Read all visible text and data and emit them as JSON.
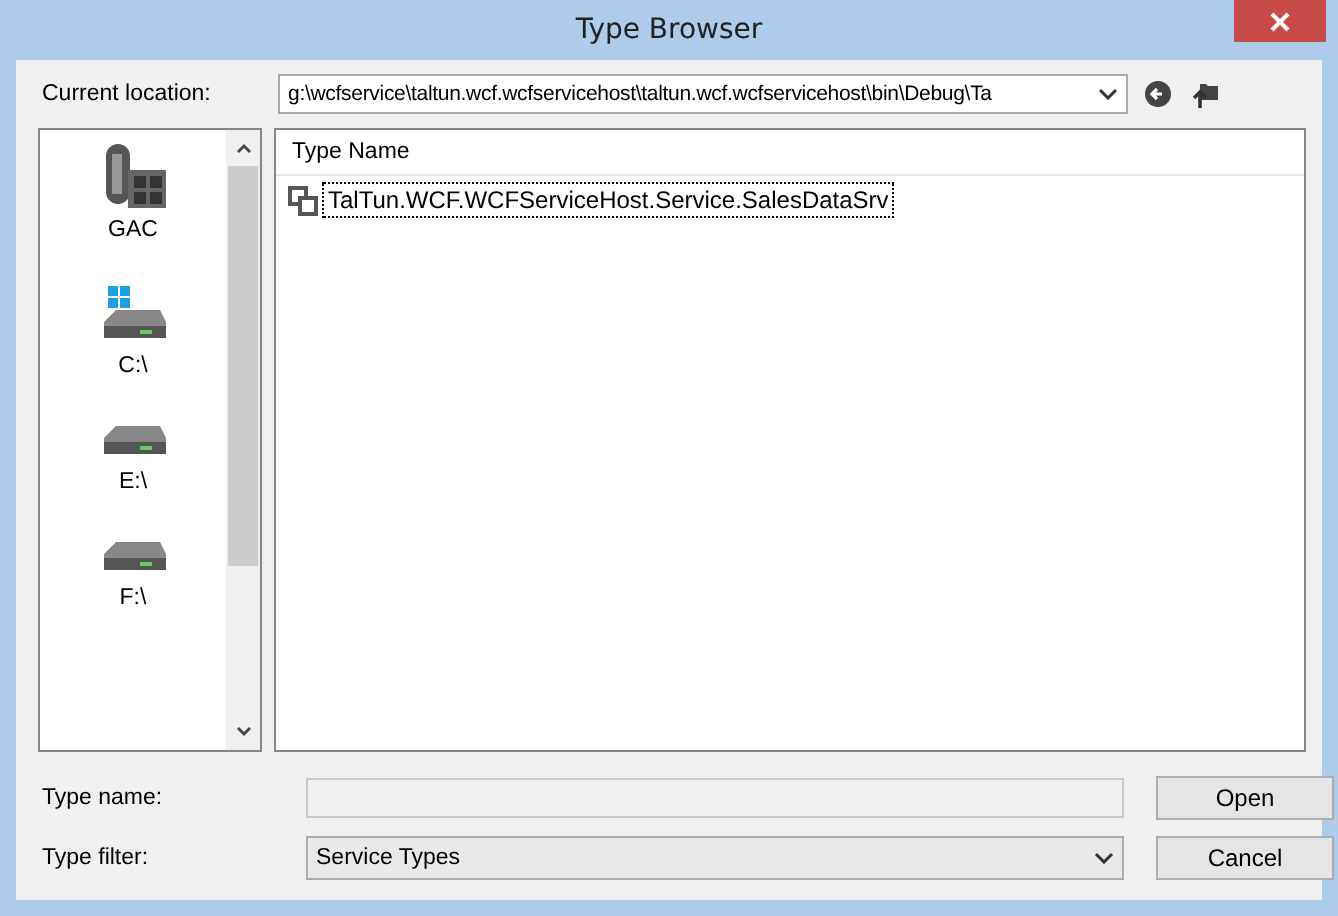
{
  "window": {
    "title": "Type Browser"
  },
  "location": {
    "label": "Current location:",
    "value": "g:\\wcfservice\\taltun.wcf.wcfservicehost\\taltun.wcf.wcfservicehost\\bin\\Debug\\Ta"
  },
  "places": [
    {
      "label": "GAC",
      "kind": "gac"
    },
    {
      "label": "C:\\",
      "kind": "system-drive"
    },
    {
      "label": "E:\\",
      "kind": "drive"
    },
    {
      "label": "F:\\",
      "kind": "drive"
    }
  ],
  "type_list": {
    "column": "Type Name",
    "rows": [
      {
        "name": "TalTun.WCF.WCFServiceHost.Service.SalesDataSrv",
        "selected": true
      }
    ]
  },
  "type_name": {
    "label": "Type name:"
  },
  "type_filter": {
    "label": "Type filter:",
    "value": "Service Types"
  },
  "buttons": [
    "Open",
    "Cancel"
  ]
}
